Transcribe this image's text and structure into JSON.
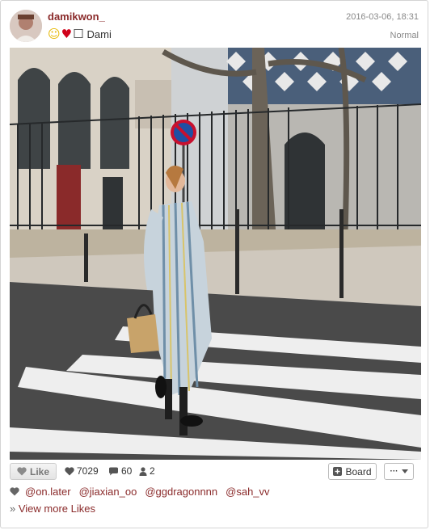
{
  "post": {
    "username": "damikwon_",
    "bio_text": "Dami",
    "bio_emojis": [
      "smile-emoji",
      "heart-emoji",
      "box-glyph"
    ],
    "timestamp": "2016-03-06, 18:31",
    "filter": "Normal"
  },
  "actions": {
    "like_label": "Like",
    "likes_count": "7029",
    "comments_count": "60",
    "users_count": "2",
    "board_label": "Board",
    "more_label": "···",
    "icons": [
      "heart-icon",
      "comment-icon",
      "user-icon",
      "plus-icon",
      "caret-down-icon"
    ]
  },
  "likers": [
    "@on.later",
    "@jiaxian_oo",
    "@ggdragonnnn",
    "@sah_vv"
  ],
  "view_more": "View more Likes",
  "colors": {
    "link": "#8a2a2a",
    "muted": "#888888"
  }
}
